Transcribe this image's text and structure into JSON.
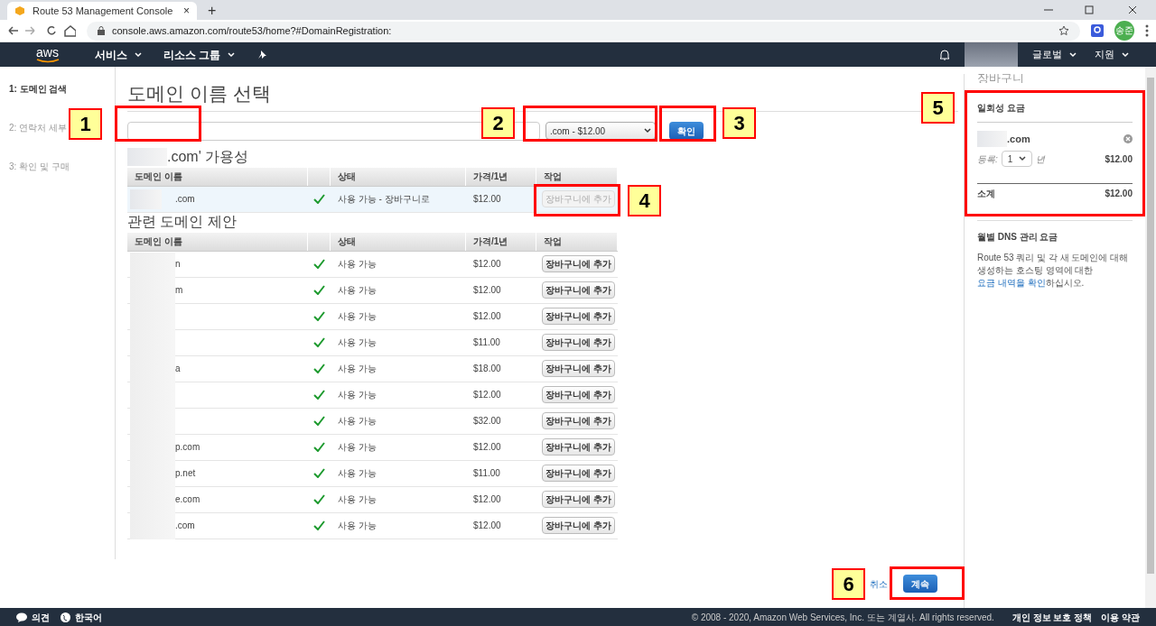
{
  "browser": {
    "tab_title": "Route 53 Management Console",
    "tab_close": "×",
    "new_tab": "+",
    "url": "console.aws.amazon.com/route53/home?#DomainRegistration:",
    "profile": "송준"
  },
  "nav": {
    "logo": "aws",
    "menus": [
      "서비스",
      "리소스 그룹"
    ],
    "right_menus": [
      "글로벌",
      "지원"
    ]
  },
  "steps": [
    {
      "label": "1: 도메인 검색",
      "selected": true
    },
    {
      "label": "2: 연락처 세부",
      "selected": false
    },
    {
      "label": "3: 확인 및 구매",
      "selected": false
    }
  ],
  "title": "도메인 이름 선택",
  "search": {
    "tld": ".com - $12.00",
    "button": "확인"
  },
  "availability": {
    "heading": ".com' 가용성",
    "columns": [
      "도메인 이름",
      "",
      "상태",
      "가격/1년",
      "작업"
    ],
    "rows": [
      {
        "name": ".com",
        "status": "사용 가능 - 장바구니로",
        "price": "$12.00",
        "action": "장바구니에 추가",
        "highlighted": true,
        "disabled": true
      }
    ]
  },
  "suggestions": {
    "heading": "관련 도메인 제안",
    "columns": [
      "도메인 이름",
      "",
      "상태",
      "가격/1년",
      "작업"
    ],
    "rows": [
      {
        "name": "n",
        "status": "사용 가능",
        "price": "$12.00",
        "action": "장바구니에 추가",
        "highlighted": false,
        "disabled": false
      },
      {
        "name": "m",
        "status": "사용 가능",
        "price": "$12.00",
        "action": "장바구니에 추가",
        "highlighted": false,
        "disabled": false
      },
      {
        "status": "사용 가능",
        "price": "$12.00",
        "action": "장바구니에 추가",
        "highlighted": false,
        "disabled": false
      },
      {
        "status": "사용 가능",
        "price": "$11.00",
        "action": "장바구니에 추가",
        "highlighted": false,
        "disabled": false
      },
      {
        "name": "a",
        "status": "사용 가능",
        "price": "$18.00",
        "action": "장바구니에 추가",
        "highlighted": false,
        "disabled": false
      },
      {
        "status": "사용 가능",
        "price": "$12.00",
        "action": "장바구니에 추가",
        "highlighted": false,
        "disabled": false
      },
      {
        "status": "사용 가능",
        "price": "$32.00",
        "action": "장바구니에 추가",
        "highlighted": false,
        "disabled": false
      },
      {
        "name": "p.com",
        "status": "사용 가능",
        "price": "$12.00",
        "action": "장바구니에 추가",
        "highlighted": false,
        "disabled": false
      },
      {
        "name": "p.net",
        "status": "사용 가능",
        "price": "$11.00",
        "action": "장바구니에 추가",
        "highlighted": false,
        "disabled": false
      },
      {
        "name": "e.com",
        "status": "사용 가능",
        "price": "$12.00",
        "action": "장바구니에 추가",
        "highlighted": false,
        "disabled": false
      },
      {
        "name": ".com",
        "status": "사용 가능",
        "price": "$12.00",
        "action": "장바구니에 추가",
        "highlighted": false,
        "disabled": false
      }
    ]
  },
  "cart": {
    "heading": "장바구니",
    "one_time": "일회성 요금",
    "item": ".com",
    "term_label": "등록:",
    "term": "1",
    "term_unit": "년",
    "item_price": "$12.00",
    "subtotal_label": "소계",
    "subtotal": "$12.00",
    "monthly": "월별 DNS 관리 요금",
    "note_before": "Route 53 쿼리 및 각 새 도메인에 대해 생성하는 호스팅 영역에 대한 ",
    "note_link": "요금 내역을 확인",
    "note_after": "하십시오."
  },
  "actions": {
    "cancel": "취소",
    "continue": "계속"
  },
  "annotations": [
    {
      "label": "1"
    },
    {
      "label": "2"
    },
    {
      "label": "3"
    },
    {
      "label": "4"
    },
    {
      "label": "5"
    },
    {
      "label": "6"
    }
  ],
  "footer": {
    "feedback": "의견",
    "language": "한국어",
    "copyright": "© 2008 - 2020, Amazon Web Services, Inc. 또는 계열사. All rights reserved.",
    "links": [
      "개인 정보 보호 정책",
      "이용 약관"
    ]
  }
}
